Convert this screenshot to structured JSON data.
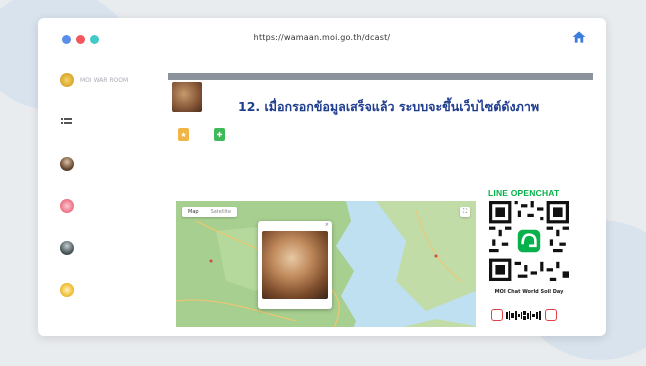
{
  "browser": {
    "url": "https://wamaan.moi.go.th/dcast/",
    "dot_colors": [
      "#5b8ee8",
      "#f0585d",
      "#43c9c7"
    ]
  },
  "sidebar": {
    "items": [
      {
        "label": "MOI WAR ROOM",
        "icon": "moi-logo-icon",
        "color": "#d9a62a"
      },
      {
        "label": "",
        "icon": "list-icon",
        "color": "#9aa0a6"
      },
      {
        "label": "",
        "icon": "avatar-icon",
        "color": "#6b4a33"
      },
      {
        "label": "",
        "icon": "flower-icon",
        "color": "#f07b8c"
      },
      {
        "label": "",
        "icon": "avatar-icon",
        "color": "#4f5b5f"
      },
      {
        "label": "",
        "icon": "flower-icon",
        "color": "#f0c03a"
      }
    ]
  },
  "main": {
    "topbar": "",
    "banner_title": "12. เมื่อกรอกข้อมูลเสร็จแล้ว ระบบจะขึ้นเว็บไซต์ดังภาพ",
    "banner_sub": "",
    "banner_line": "",
    "actions": [
      {
        "label": "",
        "color": "#f0b545",
        "glyph": "★"
      },
      {
        "label": "",
        "color": "#3fb95a",
        "glyph": "✚"
      }
    ],
    "map": {
      "tabs": [
        "Map",
        "Satellite"
      ],
      "popup_head": ""
    }
  },
  "qr": {
    "title": "LINE OPENCHAT",
    "caption": "MOI Chat World Soil Day",
    "subcaption": ""
  },
  "footer": {
    "corner_text": ""
  },
  "colors": {
    "accent": "#1f3d8f",
    "line_green": "#06b04a",
    "map_land": "#a7cf8f",
    "map_water": "#bfe0f0"
  }
}
